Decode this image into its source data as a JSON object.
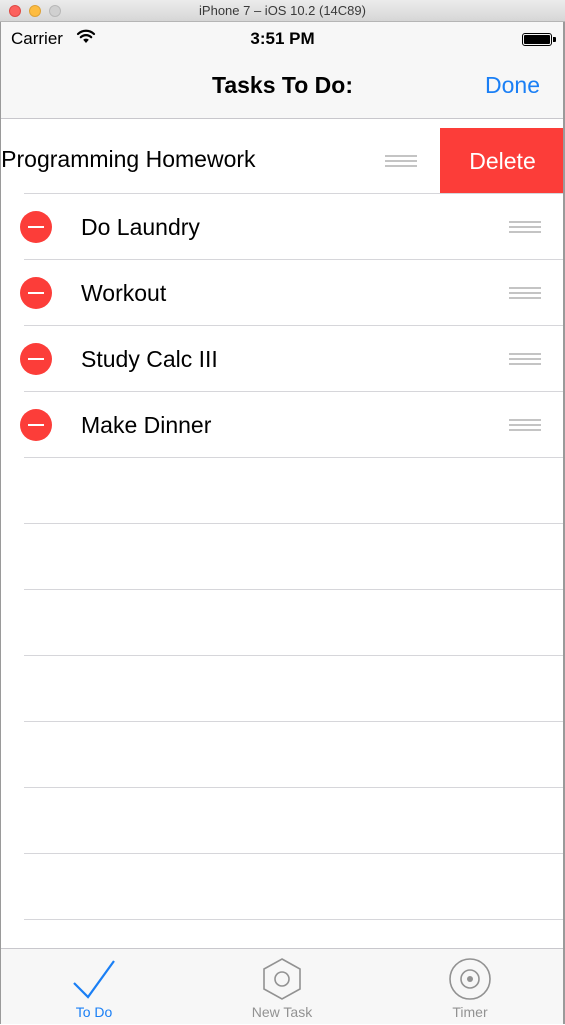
{
  "window": {
    "title": "iPhone 7 – iOS 10.2 (14C89)"
  },
  "status_bar": {
    "carrier": "Carrier",
    "time": "3:51 PM"
  },
  "nav": {
    "title": "Tasks To Do:",
    "done_label": "Done"
  },
  "swiped_row": {
    "label": "o Programming Homework",
    "delete_label": "Delete"
  },
  "tasks": [
    {
      "label": "Do Laundry"
    },
    {
      "label": "Workout"
    },
    {
      "label": "Study Calc III"
    },
    {
      "label": "Make Dinner"
    }
  ],
  "tab_bar": {
    "tabs": [
      {
        "label": "To Do",
        "icon": "checkmark-icon",
        "active": true
      },
      {
        "label": "New Task",
        "icon": "hexagon-icon",
        "active": false
      },
      {
        "label": "Timer",
        "icon": "target-icon",
        "active": false
      }
    ]
  },
  "colors": {
    "accent": "#1a7ff5",
    "destructive": "#fc3d39",
    "inactive": "#929292"
  }
}
